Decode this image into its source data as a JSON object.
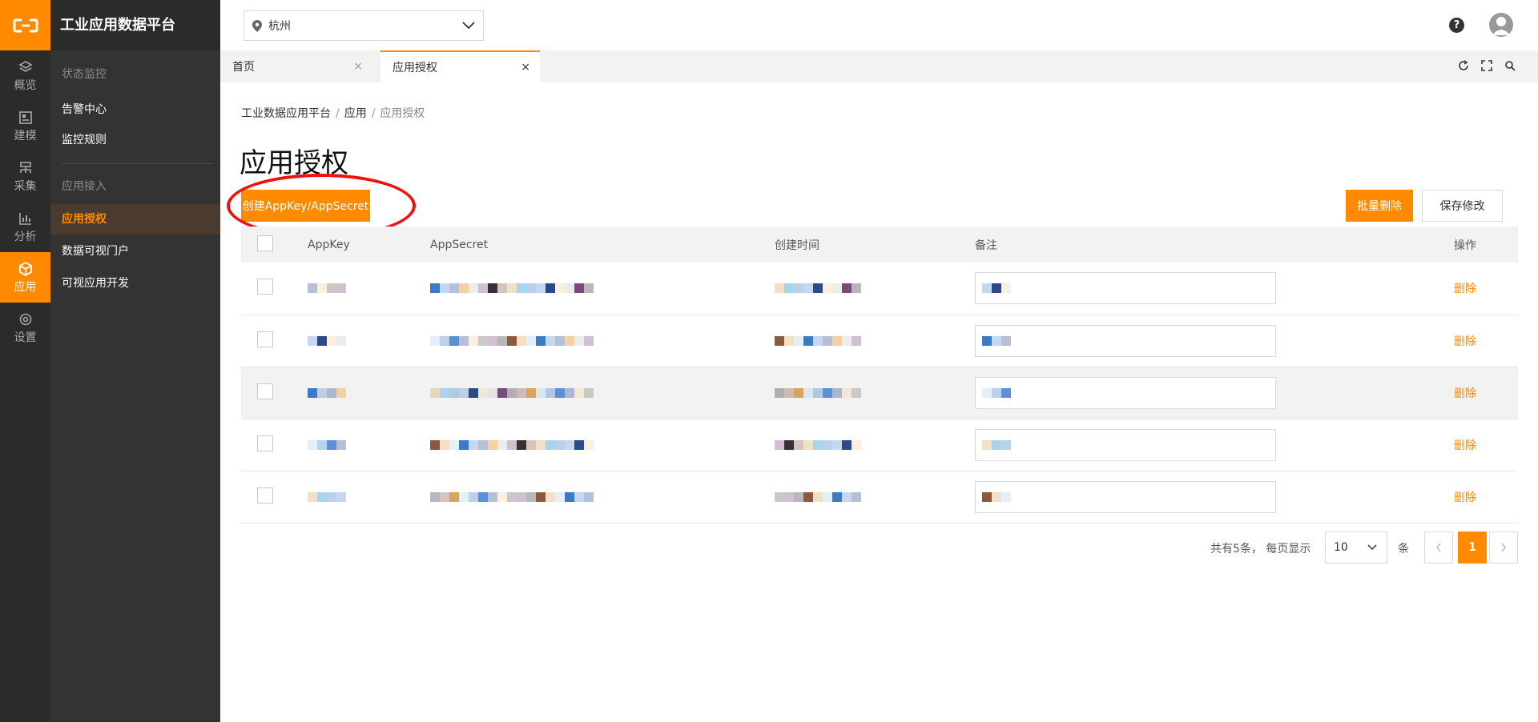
{
  "app": {
    "title": "工业应用数据平台"
  },
  "colors": {
    "accent": "#ff8a00",
    "rail_bg": "#2b2b2b",
    "sidebar_bg": "#333333",
    "danger_ring": "#e11111"
  },
  "rail": [
    {
      "label": "概览",
      "icon": "layers-icon",
      "active": false
    },
    {
      "label": "建模",
      "icon": "model-icon",
      "active": false
    },
    {
      "label": "采集",
      "icon": "collect-icon",
      "active": false
    },
    {
      "label": "分析",
      "icon": "chart-icon",
      "active": false
    },
    {
      "label": "应用",
      "icon": "cube-icon",
      "active": true
    },
    {
      "label": "设置",
      "icon": "settings-icon",
      "active": false
    }
  ],
  "sidebar": {
    "groups": [
      {
        "title": "状态监控",
        "items": [
          {
            "label": "告警中心"
          },
          {
            "label": "监控规则"
          }
        ]
      },
      {
        "title": "应用接入",
        "items": [
          {
            "label": "应用授权",
            "active": true
          },
          {
            "label": "数据可视门户"
          },
          {
            "label": "可视应用开发"
          }
        ]
      }
    ]
  },
  "topbar": {
    "city": "杭州",
    "help": "?"
  },
  "tabs": [
    {
      "label": "首页",
      "active": false
    },
    {
      "label": "应用授权",
      "active": true
    }
  ],
  "breadcrumb": [
    "工业数据应用平台",
    "应用",
    "应用授权"
  ],
  "page": {
    "title": "应用授权",
    "create_label": "创建AppKey/AppSecret",
    "batch_delete_label": "批量删除",
    "save_label": "保存修改"
  },
  "table": {
    "columns": [
      "AppKey",
      "AppSecret",
      "创建时间",
      "备注",
      "操作"
    ],
    "action_label": "删除",
    "rows": [
      {
        "key": "r1",
        "highlighted": false
      },
      {
        "key": "r2",
        "highlighted": false
      },
      {
        "key": "r3",
        "highlighted": true
      },
      {
        "key": "r4",
        "highlighted": false
      },
      {
        "key": "r5",
        "highlighted": false
      }
    ]
  },
  "pagination": {
    "total_text": "共有5条，  每页显示",
    "page_size": "10",
    "unit": "条",
    "current_page": "1"
  }
}
